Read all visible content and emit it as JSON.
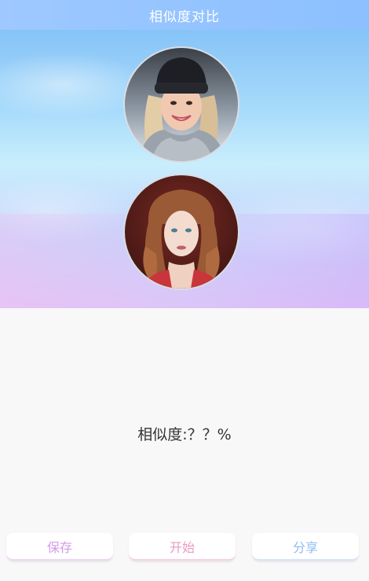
{
  "header": {
    "title": "相似度对比"
  },
  "photos": [
    {
      "description": "smiling woman in black beanie and gray scarf"
    },
    {
      "description": "woman with long curly auburn hair"
    }
  ],
  "result": {
    "label": "相似度:？？%"
  },
  "actions": {
    "save_label": "保存",
    "start_label": "开始",
    "share_label": "分享"
  },
  "colors": {
    "title_bar": "#8cc0ff",
    "save_text": "#d59ae8",
    "start_text": "#e99ac3",
    "share_text": "#8fbcf2"
  }
}
